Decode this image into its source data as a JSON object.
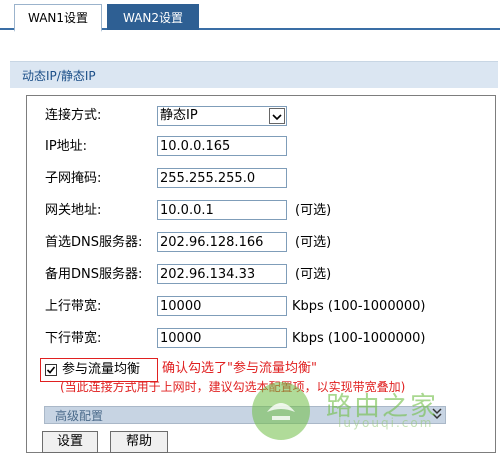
{
  "tabs": [
    {
      "label": "WAN1设置",
      "active": true
    },
    {
      "label": "WAN2设置",
      "active": false
    }
  ],
  "section": {
    "title": "动态IP/静态IP"
  },
  "form": {
    "connection": {
      "label": "连接方式:",
      "value": "静态IP"
    },
    "ip": {
      "label": "IP地址:",
      "value": "10.0.0.165"
    },
    "mask": {
      "label": "子网掩码:",
      "value": "255.255.255.0"
    },
    "gateway": {
      "label": "网关地址:",
      "value": "10.0.0.1",
      "hint": "(可选)"
    },
    "dns1": {
      "label": "首选DNS服务器:",
      "value": "202.96.128.166",
      "hint": "(可选)"
    },
    "dns2": {
      "label": "备用DNS服务器:",
      "value": "202.96.134.33",
      "hint": "(可选)"
    },
    "upload": {
      "label": "上行带宽:",
      "value": "10000",
      "unit": "Kbps (100-1000000)"
    },
    "download": {
      "label": "下行带宽:",
      "value": "10000",
      "unit": "Kbps (100-1000000)"
    },
    "balance": {
      "label": "参与流量均衡",
      "checked": true
    }
  },
  "annotation": {
    "line1": "确认勾选了\"参与流量均衡\"",
    "line2": "(当此连接方式用于上网时，建议勾选本配置项，以实现带宽叠加)"
  },
  "advanced": {
    "label": "高级配置"
  },
  "buttons": {
    "save": "设置",
    "help": "帮助"
  },
  "watermark": {
    "text": "路由之家",
    "sub": "luyouqi.com"
  },
  "colors": {
    "tab_active_bg": "#2e5f93",
    "annotation": "#e02020",
    "section_bg": "#dbe6f2"
  }
}
